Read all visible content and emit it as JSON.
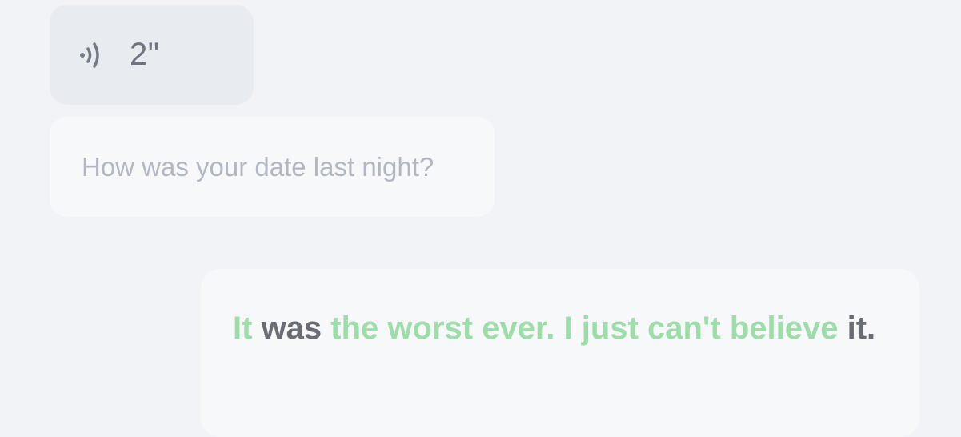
{
  "voice_message": {
    "icon": "voice-wave-icon",
    "duration": "2\""
  },
  "incoming_message": {
    "text": "How was your date last night?"
  },
  "reply_message": {
    "segments": [
      {
        "text": "It",
        "highlighted": true
      },
      {
        "text": " ",
        "highlighted": false
      },
      {
        "text": "was",
        "highlighted": false
      },
      {
        "text": " ",
        "highlighted": false
      },
      {
        "text": "the worst ever. I just can't believe",
        "highlighted": true
      },
      {
        "text": " ",
        "highlighted": false
      },
      {
        "text": "it.",
        "highlighted": false
      }
    ]
  },
  "colors": {
    "highlight": "#9edcaa",
    "plain": "#6a6d73"
  }
}
